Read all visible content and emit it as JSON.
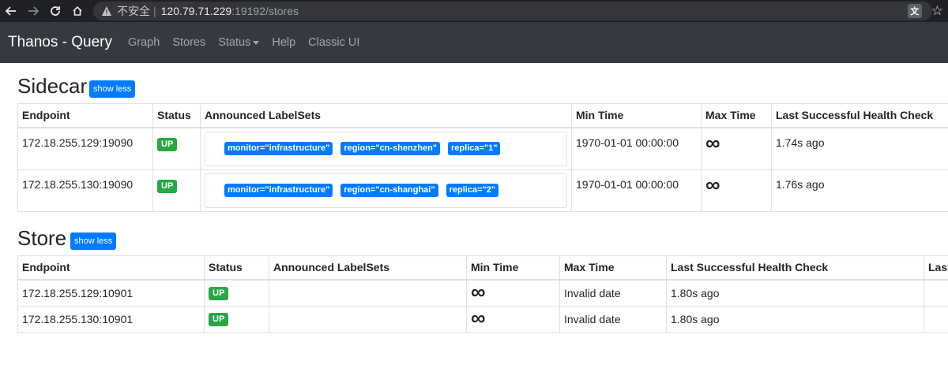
{
  "browser": {
    "insecure_text": "不安全",
    "separator": "|",
    "host": "120.79.71.229",
    "path": ":19192/stores",
    "back_icon": "back-arrow",
    "forward_icon": "forward-arrow",
    "reload_icon": "reload",
    "home_icon": "home",
    "translate_icon": "translate",
    "bookmark_icon": "star"
  },
  "navbar": {
    "brand": "Thanos - Query",
    "links": [
      "Graph",
      "Stores",
      "Status",
      "Help",
      "Classic UI"
    ]
  },
  "sidecar": {
    "title": "Sidecar",
    "toggle_label": "show less",
    "columns": [
      "Endpoint",
      "Status",
      "Announced LabelSets",
      "Min Time",
      "Max Time",
      "Last Successful Health Check"
    ],
    "rows": [
      {
        "endpoint": "172.18.255.129:19090",
        "status": "UP",
        "labels": [
          "monitor=\"infrastructure\"",
          "region=\"cn-shenzhen\"",
          "replica=\"1\""
        ],
        "min_time": "1970-01-01 00:00:00",
        "max_time": "∞",
        "last_check": "1.74s ago"
      },
      {
        "endpoint": "172.18.255.130:19090",
        "status": "UP",
        "labels": [
          "monitor=\"infrastructure\"",
          "region=\"cn-shanghai\"",
          "replica=\"2\""
        ],
        "min_time": "1970-01-01 00:00:00",
        "max_time": "∞",
        "last_check": "1.76s ago"
      }
    ]
  },
  "store": {
    "title": "Store",
    "toggle_label": "show less",
    "columns": [
      "Endpoint",
      "Status",
      "Announced LabelSets",
      "Min Time",
      "Max Time",
      "Last Successful Health Check",
      "Last"
    ],
    "rows": [
      {
        "endpoint": "172.18.255.129:10901",
        "status": "UP",
        "min_time": "∞",
        "max_time": "Invalid date",
        "last_check": "1.80s ago"
      },
      {
        "endpoint": "172.18.255.130:10901",
        "status": "UP",
        "min_time": "∞",
        "max_time": "Invalid date",
        "last_check": "1.80s ago"
      }
    ]
  },
  "colors": {
    "navbar_bg": "#343a40",
    "primary": "#007bff",
    "success": "#28a745"
  }
}
